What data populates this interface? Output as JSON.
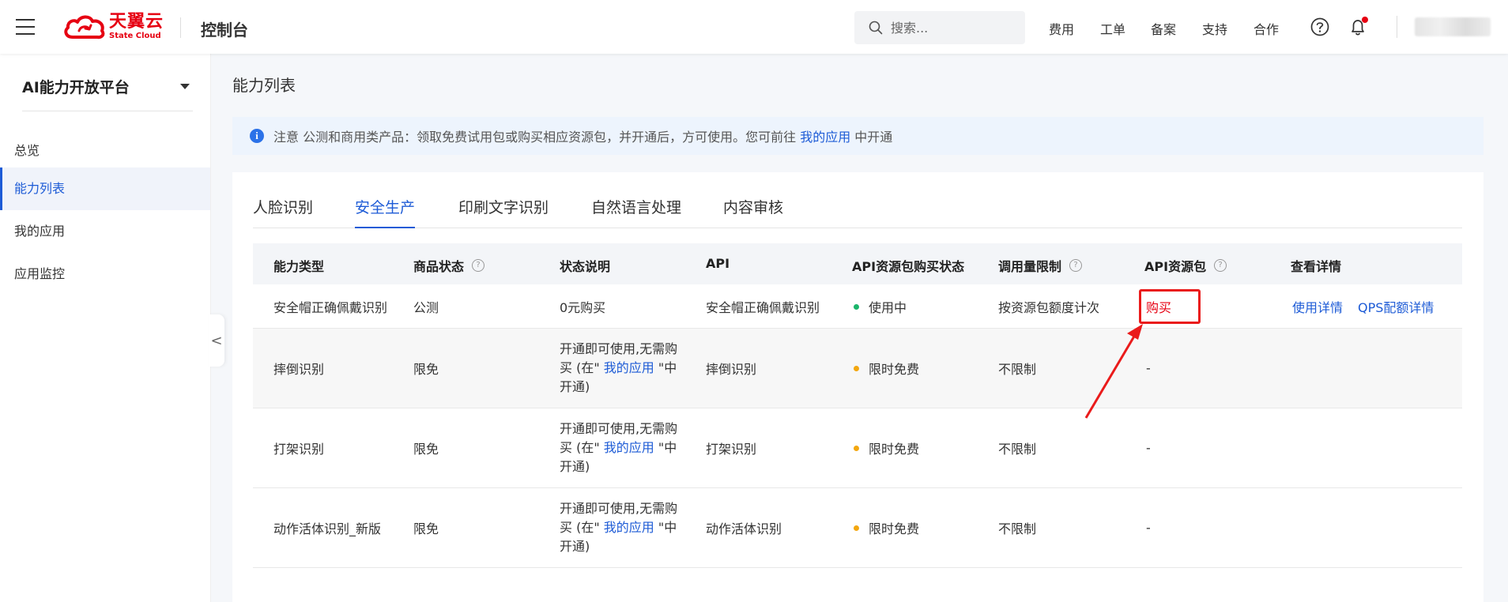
{
  "header": {
    "logo_cn": "天翼云",
    "logo_en": "State Cloud",
    "console_title": "控制台",
    "search_placeholder": "搜索...",
    "nav": [
      "费用",
      "工单",
      "备案",
      "支持",
      "合作"
    ],
    "icons": [
      "help-icon",
      "bell-icon"
    ]
  },
  "sidebar": {
    "platform": "AI能力开放平台",
    "items": [
      {
        "label": "总览",
        "active": false
      },
      {
        "label": "能力列表",
        "active": true
      },
      {
        "label": "我的应用",
        "active": false
      },
      {
        "label": "应用监控",
        "active": false
      }
    ],
    "collapse_glyph": "<"
  },
  "main": {
    "page_title": "能力列表",
    "notice": {
      "prefix": "注意 公测和商用类产品：领取免费试用包或购买相应资源包，并开通后，方可使用。您可前往",
      "link": "我的应用",
      "suffix": "中开通"
    },
    "tabs": [
      {
        "label": "人脸识别",
        "active": false
      },
      {
        "label": "安全生产",
        "active": true
      },
      {
        "label": "印刷文字识别",
        "active": false
      },
      {
        "label": "自然语言处理",
        "active": false
      },
      {
        "label": "内容审核",
        "active": false
      }
    ],
    "table": {
      "headers": [
        "能力类型",
        "商品状态",
        "状态说明",
        "API",
        "API资源包购买状态",
        "调用量限制",
        "API资源包",
        "查看详情"
      ],
      "rows": [
        {
          "type": "安全帽正确佩戴识别",
          "status": "公测",
          "desc": "0元购买",
          "api": "安全帽正确佩戴识别",
          "purchase_status": "使用中",
          "purchase_color": "green",
          "limit": "按资源包额度计次",
          "package": "购买",
          "detail_1": "使用详情",
          "detail_2": "QPS配额详情"
        },
        {
          "type": "摔倒识别",
          "status": "限免",
          "desc_line1": "开通即可使用,无需购",
          "desc_line2": "买 (在\"",
          "desc_link": "我的应用",
          "desc_line2b": "\"中",
          "desc_line3": "开通)",
          "api": "摔倒识别",
          "purchase_status": "限时免费",
          "purchase_color": "orange",
          "limit": "不限制",
          "package": "-"
        },
        {
          "type": "打架识别",
          "status": "限免",
          "desc_line1": "开通即可使用,无需购",
          "desc_line2": "买 (在\"",
          "desc_link": "我的应用",
          "desc_line2b": "\"中",
          "desc_line3": "开通)",
          "api": "打架识别",
          "purchase_status": "限时免费",
          "purchase_color": "orange",
          "limit": "不限制",
          "package": "-"
        },
        {
          "type": "动作活体识别_新版",
          "status": "限免",
          "desc_line1": "开通即可使用,无需购",
          "desc_line2": "买 (在\"",
          "desc_link": "我的应用",
          "desc_line2b": "\"中",
          "desc_line3": "开通)",
          "api": "动作活体识别",
          "purchase_status": "限时免费",
          "purchase_color": "orange",
          "limit": "不限制",
          "package": "-"
        }
      ]
    }
  },
  "colors": {
    "brand_red": "#e60012",
    "link_blue": "#1d5bd6",
    "status_green": "#1bb56b",
    "status_orange": "#f3a70f",
    "annotation_red": "#ea1b1b"
  }
}
